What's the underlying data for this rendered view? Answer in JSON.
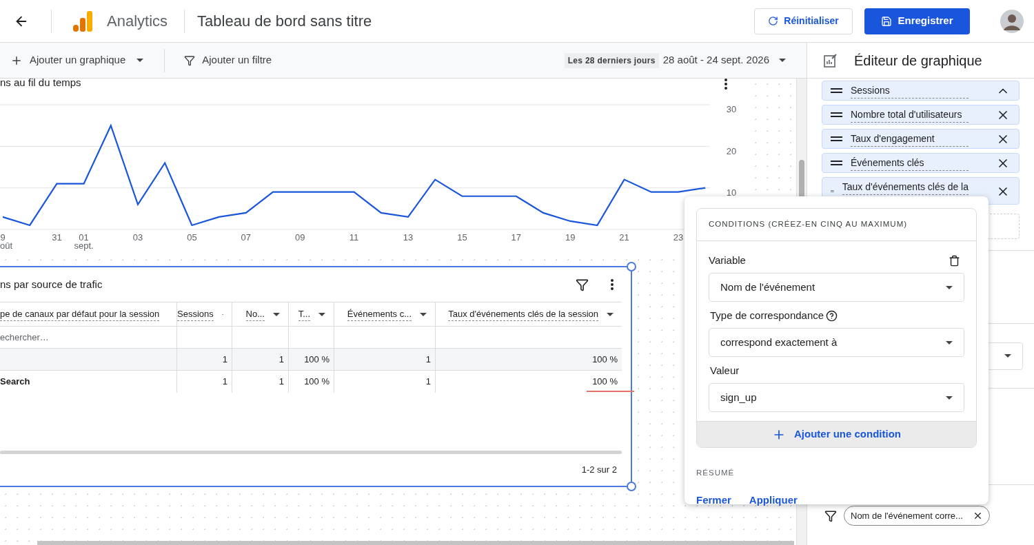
{
  "header": {
    "app_name": "Analytics",
    "dashboard_title": "Tableau de bord sans titre",
    "buttons": [
      {
        "kind": "outline",
        "label": "Réinitialiser"
      },
      {
        "kind": "primary",
        "label": "Enregistrer"
      }
    ]
  },
  "toolbar": {
    "add_chart": "Ajouter un graphique",
    "add_filter": "Ajouter un filtre",
    "date_preset": "Les 28 derniers jours",
    "date_range": "28 août - 24 sept. 2026"
  },
  "line_card": {
    "title": "ns au fil du temps",
    "month_labels": [
      "oût",
      "sept."
    ],
    "chart_data": {
      "type": "line",
      "categories": [
        "9",
        null,
        "31",
        "01",
        null,
        "03",
        null,
        "05",
        null,
        "07",
        null,
        "09",
        null,
        "11",
        null,
        "13",
        null,
        "15",
        null,
        "17",
        null,
        "19",
        null,
        "21",
        null,
        "23",
        null
      ],
      "series": [
        {
          "color": "#1a56db",
          "values": [
            3,
            1,
            11,
            11,
            25,
            6,
            16,
            1,
            3,
            4,
            9,
            9,
            9,
            9,
            4,
            3,
            12,
            8,
            8,
            8,
            4,
            2,
            1,
            12,
            9,
            9,
            10
          ]
        }
      ],
      "ylim": [
        0,
        30
      ],
      "yticks": [
        10,
        20,
        30
      ]
    }
  },
  "table_card": {
    "title": "ns par source de trafic",
    "columns": [
      "pe de canaux par défaut pour la session",
      "Sessions",
      "No...",
      "T...",
      "Événements c...",
      "Taux d'événements clés de la session"
    ],
    "search_placeholder": "echercher…",
    "rows": [
      {
        "kind": "total",
        "cells": [
          "1",
          "1",
          "100 %",
          "1",
          "100 %"
        ]
      },
      {
        "kind": "data",
        "label": "Search",
        "cells": [
          "1",
          "1",
          "100 %",
          "1",
          "100 %"
        ]
      }
    ],
    "pagination": "1-2 sur 2"
  },
  "editor": {
    "title": "Éditeur de graphique",
    "metrics": [
      {
        "label": "Sessions",
        "kind": "collapsible"
      },
      {
        "label": "Nombre total d'utilisateurs",
        "kind": "removable"
      },
      {
        "label": "Taux d'engagement",
        "kind": "removable"
      },
      {
        "label": "Événements clés",
        "kind": "removable"
      },
      {
        "label": "Taux d'événements clés de la",
        "kind": "removable"
      }
    ],
    "filter_chip": "Nom de l'événement corre..."
  },
  "condition_popup": {
    "heading": "CONDITIONS (CRÉEZ-EN CINQ AU MAXIMUM)",
    "fields": [
      {
        "kind": "deletable",
        "label": "Variable",
        "value": "Nom de l'événement"
      },
      {
        "kind": "help",
        "label": "Type de correspondance",
        "value": "correspond exactement à"
      },
      {
        "kind": "plain",
        "label": "Valeur",
        "value": "sign_up"
      }
    ],
    "add_condition": "Ajouter une condition",
    "summary_label": "RÉSUMÉ",
    "actions": [
      "Fermer",
      "Appliquer"
    ]
  }
}
